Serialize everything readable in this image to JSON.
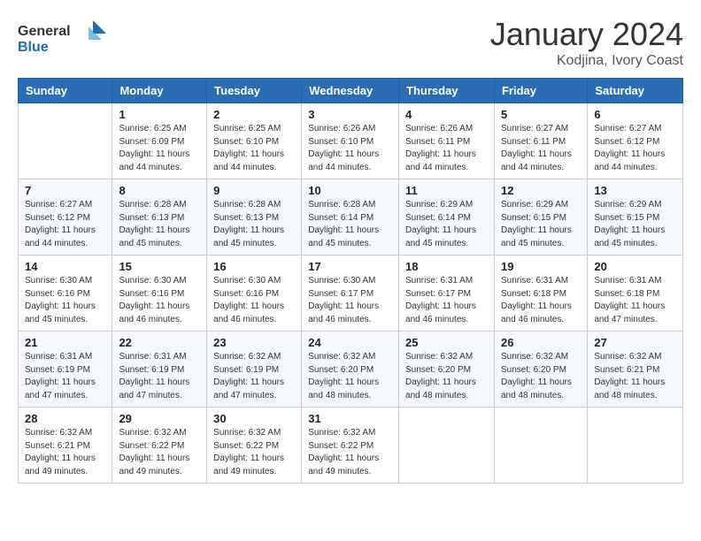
{
  "logo": {
    "general": "General",
    "blue": "Blue"
  },
  "title": "January 2024",
  "subtitle": "Kodjina, Ivory Coast",
  "days_of_week": [
    "Sunday",
    "Monday",
    "Tuesday",
    "Wednesday",
    "Thursday",
    "Friday",
    "Saturday"
  ],
  "weeks": [
    [
      {
        "day": "",
        "info": ""
      },
      {
        "day": "1",
        "info": "Sunrise: 6:25 AM\nSunset: 6:09 PM\nDaylight: 11 hours\nand 44 minutes."
      },
      {
        "day": "2",
        "info": "Sunrise: 6:25 AM\nSunset: 6:10 PM\nDaylight: 11 hours\nand 44 minutes."
      },
      {
        "day": "3",
        "info": "Sunrise: 6:26 AM\nSunset: 6:10 PM\nDaylight: 11 hours\nand 44 minutes."
      },
      {
        "day": "4",
        "info": "Sunrise: 6:26 AM\nSunset: 6:11 PM\nDaylight: 11 hours\nand 44 minutes."
      },
      {
        "day": "5",
        "info": "Sunrise: 6:27 AM\nSunset: 6:11 PM\nDaylight: 11 hours\nand 44 minutes."
      },
      {
        "day": "6",
        "info": "Sunrise: 6:27 AM\nSunset: 6:12 PM\nDaylight: 11 hours\nand 44 minutes."
      }
    ],
    [
      {
        "day": "7",
        "info": "Sunrise: 6:27 AM\nSunset: 6:12 PM\nDaylight: 11 hours\nand 44 minutes."
      },
      {
        "day": "8",
        "info": "Sunrise: 6:28 AM\nSunset: 6:13 PM\nDaylight: 11 hours\nand 45 minutes."
      },
      {
        "day": "9",
        "info": "Sunrise: 6:28 AM\nSunset: 6:13 PM\nDaylight: 11 hours\nand 45 minutes."
      },
      {
        "day": "10",
        "info": "Sunrise: 6:28 AM\nSunset: 6:14 PM\nDaylight: 11 hours\nand 45 minutes."
      },
      {
        "day": "11",
        "info": "Sunrise: 6:29 AM\nSunset: 6:14 PM\nDaylight: 11 hours\nand 45 minutes."
      },
      {
        "day": "12",
        "info": "Sunrise: 6:29 AM\nSunset: 6:15 PM\nDaylight: 11 hours\nand 45 minutes."
      },
      {
        "day": "13",
        "info": "Sunrise: 6:29 AM\nSunset: 6:15 PM\nDaylight: 11 hours\nand 45 minutes."
      }
    ],
    [
      {
        "day": "14",
        "info": "Sunrise: 6:30 AM\nSunset: 6:16 PM\nDaylight: 11 hours\nand 45 minutes."
      },
      {
        "day": "15",
        "info": "Sunrise: 6:30 AM\nSunset: 6:16 PM\nDaylight: 11 hours\nand 46 minutes."
      },
      {
        "day": "16",
        "info": "Sunrise: 6:30 AM\nSunset: 6:16 PM\nDaylight: 11 hours\nand 46 minutes."
      },
      {
        "day": "17",
        "info": "Sunrise: 6:30 AM\nSunset: 6:17 PM\nDaylight: 11 hours\nand 46 minutes."
      },
      {
        "day": "18",
        "info": "Sunrise: 6:31 AM\nSunset: 6:17 PM\nDaylight: 11 hours\nand 46 minutes."
      },
      {
        "day": "19",
        "info": "Sunrise: 6:31 AM\nSunset: 6:18 PM\nDaylight: 11 hours\nand 46 minutes."
      },
      {
        "day": "20",
        "info": "Sunrise: 6:31 AM\nSunset: 6:18 PM\nDaylight: 11 hours\nand 47 minutes."
      }
    ],
    [
      {
        "day": "21",
        "info": "Sunrise: 6:31 AM\nSunset: 6:19 PM\nDaylight: 11 hours\nand 47 minutes."
      },
      {
        "day": "22",
        "info": "Sunrise: 6:31 AM\nSunset: 6:19 PM\nDaylight: 11 hours\nand 47 minutes."
      },
      {
        "day": "23",
        "info": "Sunrise: 6:32 AM\nSunset: 6:19 PM\nDaylight: 11 hours\nand 47 minutes."
      },
      {
        "day": "24",
        "info": "Sunrise: 6:32 AM\nSunset: 6:20 PM\nDaylight: 11 hours\nand 48 minutes."
      },
      {
        "day": "25",
        "info": "Sunrise: 6:32 AM\nSunset: 6:20 PM\nDaylight: 11 hours\nand 48 minutes."
      },
      {
        "day": "26",
        "info": "Sunrise: 6:32 AM\nSunset: 6:20 PM\nDaylight: 11 hours\nand 48 minutes."
      },
      {
        "day": "27",
        "info": "Sunrise: 6:32 AM\nSunset: 6:21 PM\nDaylight: 11 hours\nand 48 minutes."
      }
    ],
    [
      {
        "day": "28",
        "info": "Sunrise: 6:32 AM\nSunset: 6:21 PM\nDaylight: 11 hours\nand 49 minutes."
      },
      {
        "day": "29",
        "info": "Sunrise: 6:32 AM\nSunset: 6:22 PM\nDaylight: 11 hours\nand 49 minutes."
      },
      {
        "day": "30",
        "info": "Sunrise: 6:32 AM\nSunset: 6:22 PM\nDaylight: 11 hours\nand 49 minutes."
      },
      {
        "day": "31",
        "info": "Sunrise: 6:32 AM\nSunset: 6:22 PM\nDaylight: 11 hours\nand 49 minutes."
      },
      {
        "day": "",
        "info": ""
      },
      {
        "day": "",
        "info": ""
      },
      {
        "day": "",
        "info": ""
      }
    ]
  ]
}
